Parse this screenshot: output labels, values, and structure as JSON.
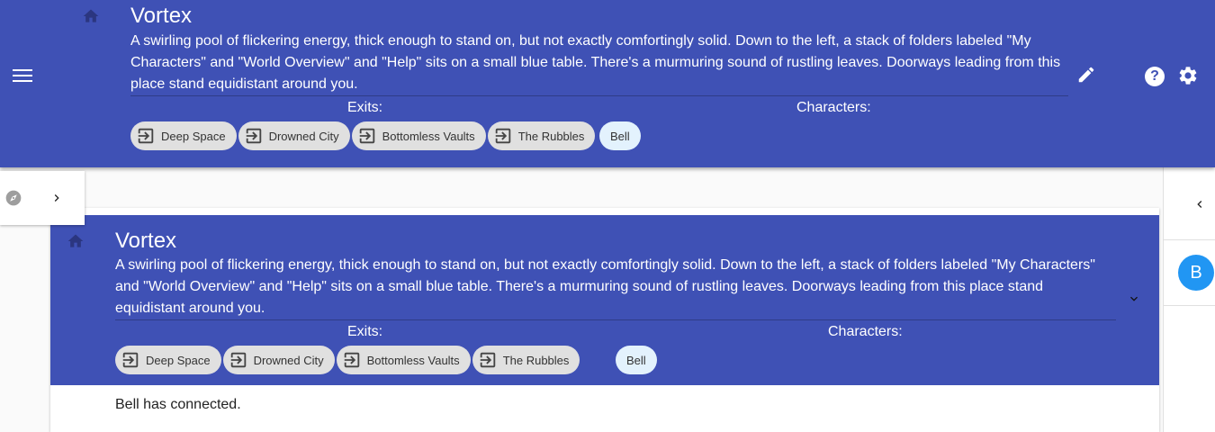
{
  "header": {
    "title": "Vortex",
    "description": "A swirling pool of flickering energy, thick enough to stand on, but not exactly comfortingly solid. Down to the left, a stack of folders labeled \"My Characters\" and \"World Overview\" and \"Help\" sits on a small blue table. There's a murmuring sound of rustling leaves. Doorways leading from this place stand equidistant around you.",
    "exits_label": "Exits:",
    "characters_label": "Characters:",
    "exits": [
      "Deep Space",
      "Drowned City",
      "Bottomless Vaults",
      "The Rubbles"
    ],
    "characters": [
      "Bell"
    ],
    "help_label": "?"
  },
  "card": {
    "title": "Vortex",
    "description": "A swirling pool of flickering energy, thick enough to stand on, but not exactly comfortingly solid. Down to the left, a stack of folders labeled \"My Characters\" and \"World Overview\" and \"Help\" sits on a small blue table. There's a murmuring sound of rustling leaves. Doorways leading from this place stand equidistant around you.",
    "exits_label": "Exits:",
    "characters_label": "Characters:",
    "exits": [
      "Deep Space",
      "Drowned City",
      "Bottomless Vaults",
      "The Rubbles"
    ],
    "characters": [
      "Bell"
    ],
    "message": "Bell has connected."
  },
  "right_panel": {
    "avatar_letter": "B"
  },
  "icons": {
    "menu": "menu-icon",
    "home": "home-icon",
    "exit": "exit-to-app-icon",
    "edit": "pencil-icon",
    "help": "help-circle-icon",
    "settings": "gear-icon",
    "compass": "compass-icon",
    "chevron_right": "chevron-right-icon",
    "chevron_left": "chevron-left-icon",
    "expand": "chevron-down-icon"
  },
  "colors": {
    "primary": "#3f51b5",
    "chip": "#e0e0e0",
    "character_chip": "#e3f2fd",
    "avatar": "#2196f3"
  }
}
